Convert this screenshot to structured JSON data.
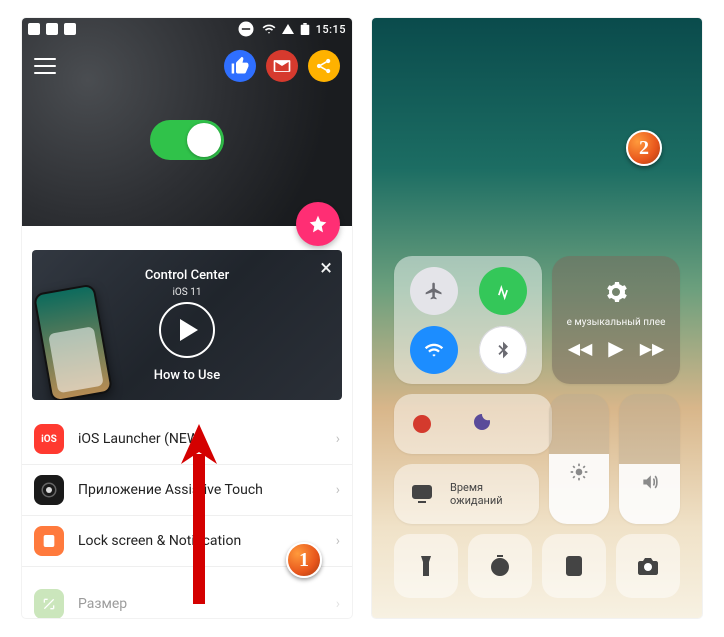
{
  "left": {
    "statusbar": {
      "time": "15:15"
    },
    "toggle_on": true,
    "video": {
      "title": "Control Center",
      "version": "iOS 11",
      "howto": "How to Use"
    },
    "rows": [
      {
        "icon_text": "iOS",
        "label": "iOS Launcher (NEW)"
      },
      {
        "icon_text": "",
        "label": "Приложение Assistive Touch"
      },
      {
        "icon_text": "",
        "label": "Lock screen & Notification"
      },
      {
        "icon_text": "",
        "label": "Размер"
      }
    ]
  },
  "right": {
    "music": {
      "text": "е музыкальный плее"
    },
    "screen_mirroring": {
      "line1": "Время",
      "line2": "ожиданий"
    },
    "brightness_pct": 54,
    "volume_pct": 46
  },
  "badges": {
    "one": "1",
    "two": "2"
  }
}
